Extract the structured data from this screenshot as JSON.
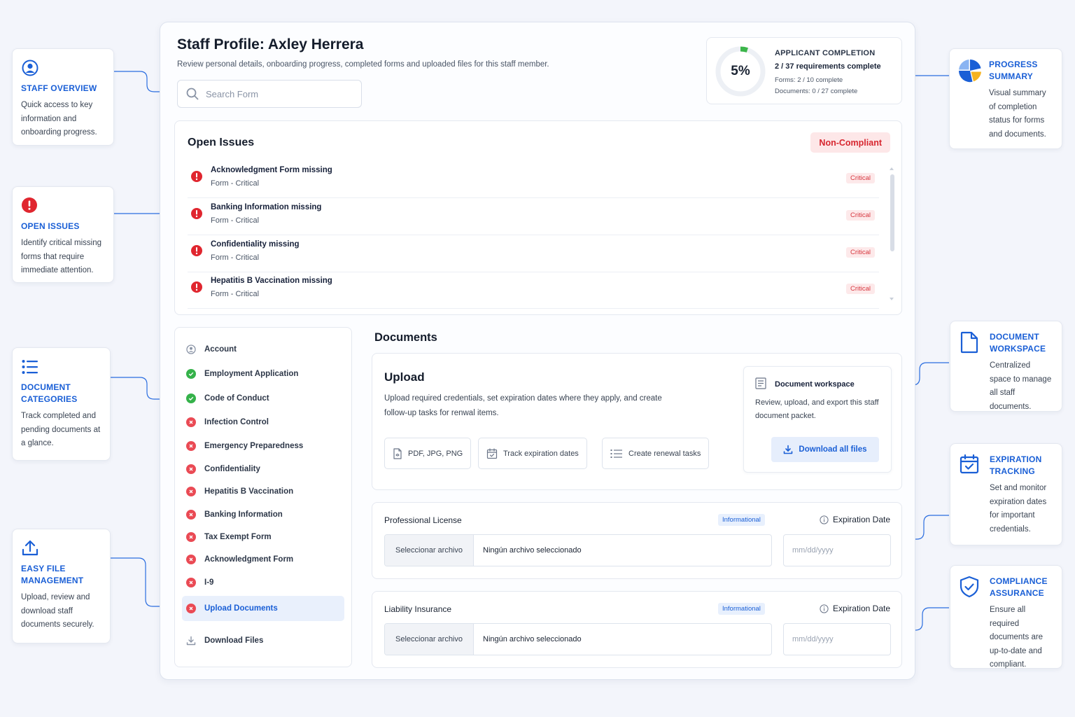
{
  "callouts": {
    "staff_overview": {
      "title": "STAFF OVERVIEW",
      "desc": "Quick access to key information and onboarding progress.",
      "icon": "user-circle-icon"
    },
    "open_issues": {
      "title": "OPEN ISSUES",
      "desc": "Identify critical missing forms that require immediate attention.",
      "icon": "alert-icon"
    },
    "document_categories": {
      "title": "DOCUMENT CATEGORIES",
      "desc": "Track completed and pending documents at a glance.",
      "icon": "list-icon"
    },
    "easy_file": {
      "title": "EASY FILE MANAGEMENT",
      "desc": "Upload, review and download staff documents securely.",
      "icon": "upload-icon"
    },
    "progress_summary": {
      "title": "PROGRESS SUMMARY",
      "desc": "Visual summary of completion status for forms and documents.",
      "icon": "pie-chart-icon"
    },
    "document_workspace": {
      "title": "DOCUMENT WORKSPACE",
      "desc": "Centralized space to manage all staff documents.",
      "icon": "document-icon"
    },
    "expiration_tracking": {
      "title": "EXPIRATION TRACKING",
      "desc": "Set and monitor expiration dates for important credentials.",
      "icon": "calendar-check-icon"
    },
    "compliance": {
      "title": "COMPLIANCE ASSURANCE",
      "desc": "Ensure all required documents are up-to-date and compliant.",
      "icon": "shield-check-icon"
    }
  },
  "header": {
    "title": "Staff Profile: Axley Herrera",
    "subtitle": "Review personal details, onboarding progress, completed forms and uploaded files for this staff member.",
    "search_placeholder": "Search Form"
  },
  "progress": {
    "percent_label": "5%",
    "percent_value": 5,
    "title": "APPLICANT COMPLETION",
    "requirements": "2 / 37 requirements complete",
    "forms": "Forms: 2 / 10 complete",
    "documents": "Documents: 0 / 27 complete",
    "ring_color": "#3bb54a"
  },
  "issues": {
    "title": "Open Issues",
    "status": "Non-Compliant",
    "items": [
      {
        "name": "Acknowledgment Form missing",
        "type": "Form - Critical",
        "severity": "Critical"
      },
      {
        "name": "Banking Information missing",
        "type": "Form - Critical",
        "severity": "Critical"
      },
      {
        "name": "Confidentiality missing",
        "type": "Form - Critical",
        "severity": "Critical"
      },
      {
        "name": "Hepatitis B Vaccination missing",
        "type": "Form - Critical",
        "severity": "Critical"
      }
    ]
  },
  "sidebar": {
    "items": [
      {
        "label": "Account",
        "status": "account"
      },
      {
        "label": "Employment Application",
        "status": "complete"
      },
      {
        "label": "Code of Conduct",
        "status": "complete"
      },
      {
        "label": "Infection Control",
        "status": "missing"
      },
      {
        "label": "Emergency Preparedness",
        "status": "missing"
      },
      {
        "label": "Confidentiality",
        "status": "missing"
      },
      {
        "label": "Hepatitis B Vaccination",
        "status": "missing"
      },
      {
        "label": "Banking Information",
        "status": "missing"
      },
      {
        "label": "Tax Exempt Form",
        "status": "missing"
      },
      {
        "label": "Acknowledgment Form",
        "status": "missing"
      },
      {
        "label": "I-9",
        "status": "missing"
      },
      {
        "label": "Upload Documents",
        "status": "missing",
        "active": true
      },
      {
        "label": "Download Files",
        "status": "download"
      }
    ]
  },
  "documents": {
    "title": "Documents",
    "upload": {
      "title": "Upload",
      "desc": "Upload required credentials, set expiration dates where they apply, and create follow-up tasks for renwal items.",
      "chips": [
        "PDF, JPG, PNG",
        "Track expiration dates",
        "Create renewal tasks"
      ]
    },
    "workspace": {
      "title": "Document workspace",
      "desc": "Review, upload, and export this staff document packet.",
      "button": "Download all files"
    },
    "files": [
      {
        "name": "Professional License",
        "badge": "Informational",
        "exp_label": "Expiration Date",
        "file_button": "Seleccionar archivo",
        "file_status": "Ningún archivo seleccionado",
        "date_placeholder": "mm/dd/yyyy"
      },
      {
        "name": "Liability Insurance",
        "badge": "Informational",
        "exp_label": "Expiration Date",
        "file_button": "Seleccionar archivo",
        "file_status": "Ningún archivo seleccionado",
        "date_placeholder": "mm/dd/yyyy"
      }
    ]
  },
  "colors": {
    "accent": "#1a5fd6",
    "critical": "#e0262f",
    "complete": "#35b24a",
    "missing": "#ea4a54"
  }
}
